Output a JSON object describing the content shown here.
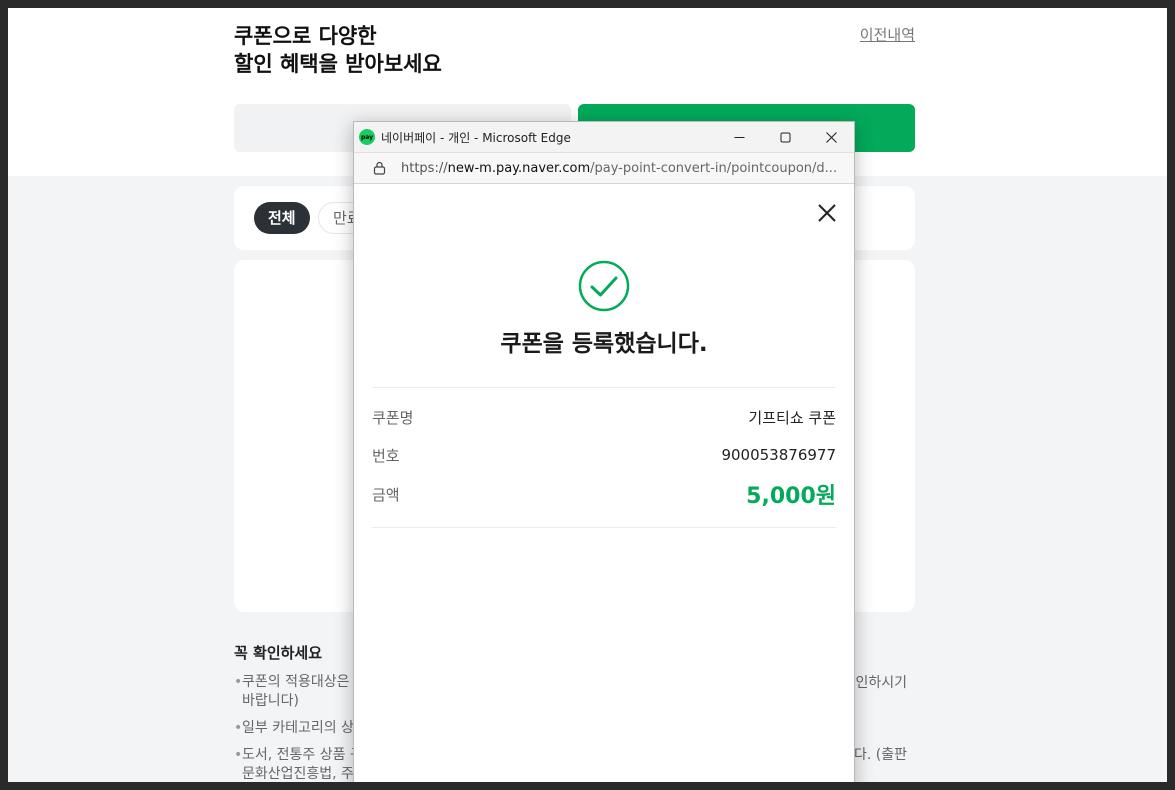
{
  "page": {
    "headline_line1": "쿠폰으로 다양한",
    "headline_line2": "할인 혜택을 받아보세요",
    "history_link": "이전내역",
    "filters": {
      "all": "전체",
      "expired": "만료"
    },
    "notice": {
      "title": "꼭 확인하세요",
      "item1_left": "쿠폰의 적용대상은",
      "item1_right": "인하시기",
      "item1_cont": "바랍니다)",
      "item2_left": "일부 카테고리의 상",
      "item3_left": "도서, 전통주 상품 구",
      "item3_right": "다. (출판",
      "item3_cont": "문화산업진흥법, 주"
    }
  },
  "popup": {
    "window_title": "네이버페이 - 개인 - Microsoft Edge",
    "app_icon_text": "pay",
    "url_scheme": "https://",
    "url_host": "new-m.pay.naver.com",
    "url_path": "/pay-point-convert-in/pointcoupon/d...",
    "success_title": "쿠폰을 등록했습니다.",
    "rows": [
      {
        "label": "쿠폰명",
        "value": "기프티쇼 쿠폰"
      },
      {
        "label": "번호",
        "value": "900053876977"
      },
      {
        "label": "금액",
        "value": "5,000원"
      }
    ]
  },
  "colors": {
    "brand_green": "#03aa5a",
    "chip_dark": "#2b3137"
  }
}
